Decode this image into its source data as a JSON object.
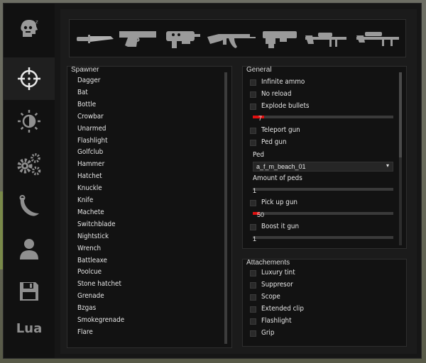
{
  "sidebar": {
    "items": [
      {
        "name": "head-icon"
      },
      {
        "name": "crosshair-icon"
      },
      {
        "name": "brightness-icon"
      },
      {
        "name": "gears-icon"
      },
      {
        "name": "karambit-icon"
      },
      {
        "name": "user-icon"
      },
      {
        "name": "save-icon"
      },
      {
        "name": "lua-icon",
        "label": "Lua"
      }
    ]
  },
  "weapons_bar": {
    "items": [
      "knife-icon",
      "pistol-icon",
      "smg-icon",
      "rifle-icon",
      "shotgun-icon",
      "sniper-icon",
      "heavy-sniper-icon"
    ]
  },
  "spawner": {
    "title": "Spawner",
    "items": [
      "Dagger",
      "Bat",
      "Bottle",
      "Crowbar",
      "Unarmed",
      "Flashlight",
      "Golfclub",
      "Hammer",
      "Hatchet",
      "Knuckle",
      "Knife",
      "Machete",
      "Switchblade",
      "Nightstick",
      "Wrench",
      "Battleaxe",
      "Poolcue",
      "Stone hatchet",
      "Grenade",
      "Bzgas",
      "Smokegrenade",
      "Flare"
    ]
  },
  "general": {
    "title": "General",
    "infinite_ammo": "Infinite ammo",
    "no_reload": "No reload",
    "explode_bullets": "Explode bullets",
    "slider1_value": "7",
    "slider1_fraction": 0.08,
    "teleport_gun": "Teleport gun",
    "ped_gun": "Ped gun",
    "ped_label": "Ped",
    "ped_value": "a_f_m_beach_01",
    "amount_label": "Amount of peds",
    "amount_value": "1",
    "amount_fraction": 0.0,
    "pick_up_gun": "Pick up gun",
    "pickup_value": "50",
    "pickup_fraction": 0.05,
    "boost_it_gun": "Boost it gun",
    "boost_value": "1",
    "boost_fraction": 0.0
  },
  "attachments": {
    "title": "Attachements",
    "items": [
      "Luxury tint",
      "Suppresor",
      "Scope",
      "Extended clip",
      "Flashlight",
      "Grip"
    ]
  },
  "colors": {
    "accent": "#e01010"
  }
}
